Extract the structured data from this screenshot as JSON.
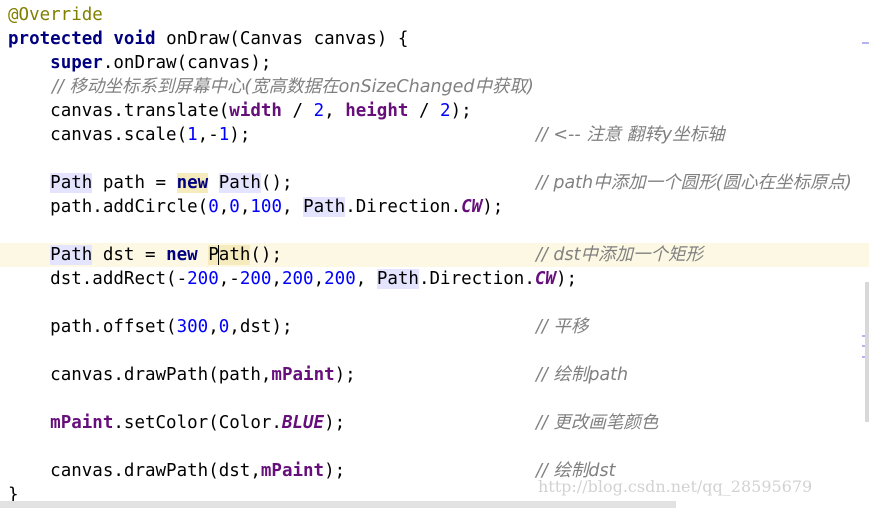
{
  "code": {
    "l1_annotation": "@Override",
    "l2_kw1": "protected",
    "l2_kw2": "void",
    "l2_rest": " onDraw(Canvas canvas) {",
    "l3_super": "super",
    "l3_rest": ".onDraw(canvas);",
    "l4_comment": "// 移动坐标系到屏幕中心(宽高数据在onSizeChanged中获取)",
    "l5_a": "canvas.translate(",
    "l5_width": "width",
    "l5_op1": " / ",
    "l5_n1": "2",
    "l5_sep": ", ",
    "l5_height": "height",
    "l5_op2": " / ",
    "l5_n2": "2",
    "l5_end": ");",
    "l6_a": "canvas.scale(",
    "l6_n1": "1",
    "l6_sep": ",-",
    "l6_n2": "1",
    "l6_end": ");",
    "l6_comment": "// <-- 注意 翻转y坐标轴",
    "l7_cls": "Path",
    "l7_var": " path = ",
    "l7_new": "new",
    "l7_sp": " ",
    "l7_cls2": "Path",
    "l7_end": "();",
    "l7_comment": "// path中添加一个圆形(圆心在坐标原点)",
    "l8_a": "path.addCircle(",
    "l8_n1": "0",
    "l8_c1": ",",
    "l8_n2": "0",
    "l8_c2": ",",
    "l8_n3": "100",
    "l8_sep": ", ",
    "l8_cls": "Path",
    "l8_b": ".Direction.",
    "l8_cw": "CW",
    "l8_end": ");",
    "l9_cls": "Path",
    "l9_var": " dst = ",
    "l9_new": "new",
    "l9_sp": " ",
    "l9_p1": "P",
    "l9_p2": "ath",
    "l9_end": "();",
    "l9_comment": "// dst中添加一个矩形",
    "l10_a": "dst.addRect(-",
    "l10_n1": "200",
    "l10_c1": ",-",
    "l10_n2": "200",
    "l10_c2": ",",
    "l10_n3": "200",
    "l10_c3": ",",
    "l10_n4": "200",
    "l10_sep": ", ",
    "l10_cls": "Path",
    "l10_b": ".Direction.",
    "l10_cw": "CW",
    "l10_end": ");",
    "l11_a": "path.offset(",
    "l11_n1": "300",
    "l11_c1": ",",
    "l11_n2": "0",
    "l11_end": ",dst);",
    "l11_comment": "// 平移",
    "l12_a": "canvas.drawPath(path,",
    "l12_fld": "mPaint",
    "l12_end": ");",
    "l12_comment": "// 绘制path",
    "l13_fld": "mPaint",
    "l13_a": ".setColor(Color.",
    "l13_blue": "BLUE",
    "l13_end": ");",
    "l13_comment": "// 更改画笔颜色",
    "l14_a": "canvas.drawPath(dst,",
    "l14_fld": "mPaint",
    "l14_end": ");",
    "l14_comment": "// 绘制dst",
    "l15_brace": "}"
  },
  "watermark": "http://blog.csdn.net/qq_28595679",
  "colors": {
    "keyword": "#000080",
    "number": "#0000ff",
    "comment": "#808080",
    "field": "#660e7a",
    "annotation": "#808000",
    "current_line": "#fdf8e3"
  }
}
